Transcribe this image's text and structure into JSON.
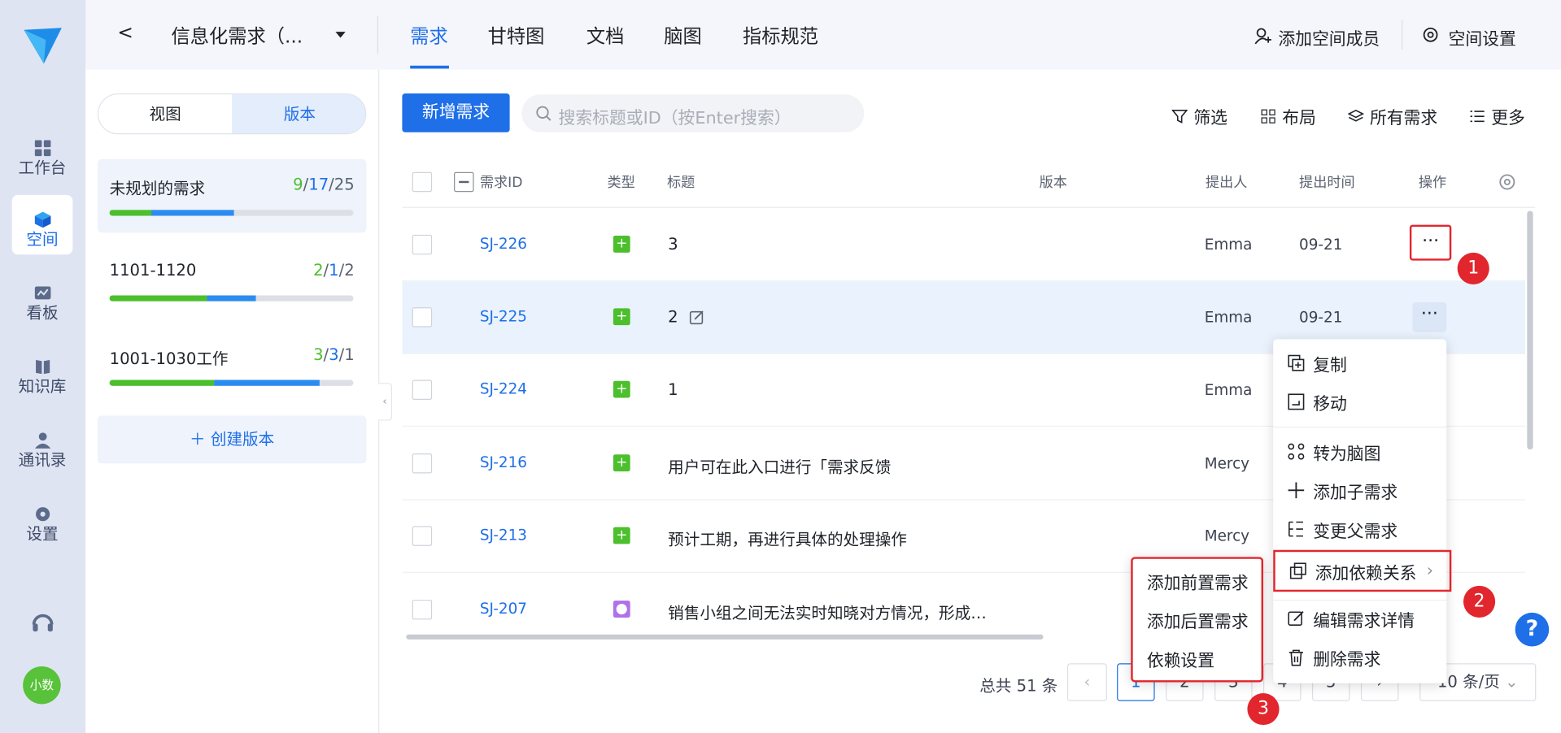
{
  "rail": {
    "items": [
      {
        "label": "工作台"
      },
      {
        "label": "空间"
      },
      {
        "label": "看板"
      },
      {
        "label": "知识库"
      },
      {
        "label": "通讯录"
      },
      {
        "label": "设置"
      }
    ],
    "avatar": "小数"
  },
  "header": {
    "back": "<",
    "space_name": "信息化需求（...",
    "tabs": [
      {
        "label": "需求"
      },
      {
        "label": "甘特图"
      },
      {
        "label": "文档"
      },
      {
        "label": "脑图"
      },
      {
        "label": "指标规范"
      }
    ],
    "add_member": "添加空间成员",
    "space_settings": "空间设置"
  },
  "version_panel": {
    "seg": [
      "视图",
      "版本"
    ],
    "cards": [
      {
        "name": "未规划的需求",
        "c1": "9",
        "c2": "17",
        "c3": "25",
        "done": 0.17,
        "doing": 0.34
      },
      {
        "name": "1101-1120",
        "c1": "2",
        "c2": "1",
        "c3": "2",
        "done": 0.4,
        "doing": 0.2
      },
      {
        "name": "1001-1030工作",
        "c1": "3",
        "c2": "3",
        "c3": "1",
        "done": 0.43,
        "doing": 0.43
      }
    ],
    "create": "创建版本"
  },
  "toolbar": {
    "new_button": "新增需求",
    "search_placeholder": "搜索标题或ID（按Enter搜索）",
    "filter": "筛选",
    "layout": "布局",
    "all": "所有需求",
    "more": "更多"
  },
  "table": {
    "headers": {
      "id": "需求ID",
      "type": "类型",
      "title": "标题",
      "version": "版本",
      "proposer": "提出人",
      "time": "提出时间",
      "ops": "操作"
    },
    "rows": [
      {
        "id": "SJ-226",
        "title": "3",
        "proposer": "Emma",
        "time": "09-21"
      },
      {
        "id": "SJ-225",
        "title": "2",
        "proposer": "Emma",
        "time": "09-21"
      },
      {
        "id": "SJ-224",
        "title": "1",
        "proposer": "Emma",
        "time": ""
      },
      {
        "id": "SJ-216",
        "title": "用户可在此入口进行「需求反馈",
        "proposer": "Mercy",
        "time": ""
      },
      {
        "id": "SJ-213",
        "title": "预计工期，再进行具体的处理操作",
        "proposer": "Mercy",
        "time": ""
      },
      {
        "id": "SJ-207",
        "title": "销售小组之间无法实时知晓对方情况，形成…",
        "proposer": "",
        "time": ""
      }
    ],
    "more_glyph": "···"
  },
  "context_menu": {
    "items": [
      "复制",
      "移动",
      "转为脑图",
      "添加子需求",
      "变更父需求",
      "添加依赖关系",
      "编辑需求详情",
      "删除需求"
    ]
  },
  "submenu": {
    "items": [
      "添加前置需求",
      "添加后置需求",
      "依赖设置"
    ]
  },
  "badges": [
    "1",
    "2",
    "3"
  ],
  "pagination": {
    "total": "总共 51 条",
    "pages": [
      "1",
      "2",
      "3",
      "4",
      "5"
    ],
    "page_size": "10 条/页"
  },
  "help": "?",
  "colors": {
    "accent": "#1e6fe8",
    "green": "#4bbf2c",
    "red": "#e2262d",
    "purple": "#b070e8"
  }
}
